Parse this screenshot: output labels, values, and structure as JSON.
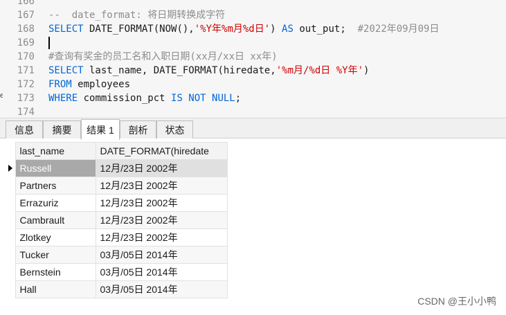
{
  "editor": {
    "lines": [
      {
        "num": "166",
        "parts": []
      },
      {
        "num": "167",
        "parts": [
          {
            "t": "--  date_format: 将日期转换成字符",
            "c": "cmt"
          }
        ]
      },
      {
        "num": "168",
        "parts": [
          {
            "t": "SELECT",
            "c": "kw"
          },
          {
            "t": " DATE_FORMAT(NOW(),",
            "c": ""
          },
          {
            "t": "'%Y年%m月%d日'",
            "c": "str"
          },
          {
            "t": ") ",
            "c": ""
          },
          {
            "t": "AS",
            "c": "kw"
          },
          {
            "t": " out_put;  ",
            "c": ""
          },
          {
            "t": "#2022年09月09日",
            "c": "cmt"
          }
        ]
      },
      {
        "num": "169",
        "parts": [],
        "caret": true
      },
      {
        "num": "170",
        "parts": [
          {
            "t": "#查询有奖金的员工名和入职日期(xx月/xx日 xx年)",
            "c": "cmt"
          }
        ]
      },
      {
        "num": "171",
        "parts": [
          {
            "t": "SELECT",
            "c": "kw"
          },
          {
            "t": " last_name, DATE_FORMAT(hiredate,",
            "c": ""
          },
          {
            "t": "'%m月/%d日 %Y年'",
            "c": "str"
          },
          {
            "t": ")",
            "c": ""
          }
        ]
      },
      {
        "num": "172",
        "parts": [
          {
            "t": "FROM",
            "c": "kw"
          },
          {
            "t": " employees",
            "c": ""
          }
        ]
      },
      {
        "num": "173",
        "parts": [
          {
            "t": "WHERE",
            "c": "kw"
          },
          {
            "t": " commission_pct ",
            "c": ""
          },
          {
            "t": "IS NOT NULL",
            "c": "kw"
          },
          {
            "t": ";",
            "c": ""
          }
        ]
      },
      {
        "num": "174",
        "parts": []
      }
    ],
    "edge_mark": "e"
  },
  "tabs": [
    {
      "label": "信息",
      "active": false
    },
    {
      "label": "摘要",
      "active": false
    },
    {
      "label": "结果 1",
      "active": true
    },
    {
      "label": "剖析",
      "active": false
    },
    {
      "label": "状态",
      "active": false
    }
  ],
  "result": {
    "columns": [
      "last_name",
      "DATE_FORMAT(hiredate"
    ],
    "rows": [
      [
        "Russell",
        "12月/23日 2002年"
      ],
      [
        "Partners",
        "12月/23日 2002年"
      ],
      [
        "Errazuriz",
        "12月/23日 2002年"
      ],
      [
        "Cambrault",
        "12月/23日 2002年"
      ],
      [
        "Zlotkey",
        "12月/23日 2002年"
      ],
      [
        "Tucker",
        "03月/05日 2014年"
      ],
      [
        "Bernstein",
        "03月/05日 2014年"
      ],
      [
        "Hall",
        "03月/05日 2014年"
      ]
    ],
    "selected_row": 0
  },
  "watermark": "CSDN @王小小鸭"
}
